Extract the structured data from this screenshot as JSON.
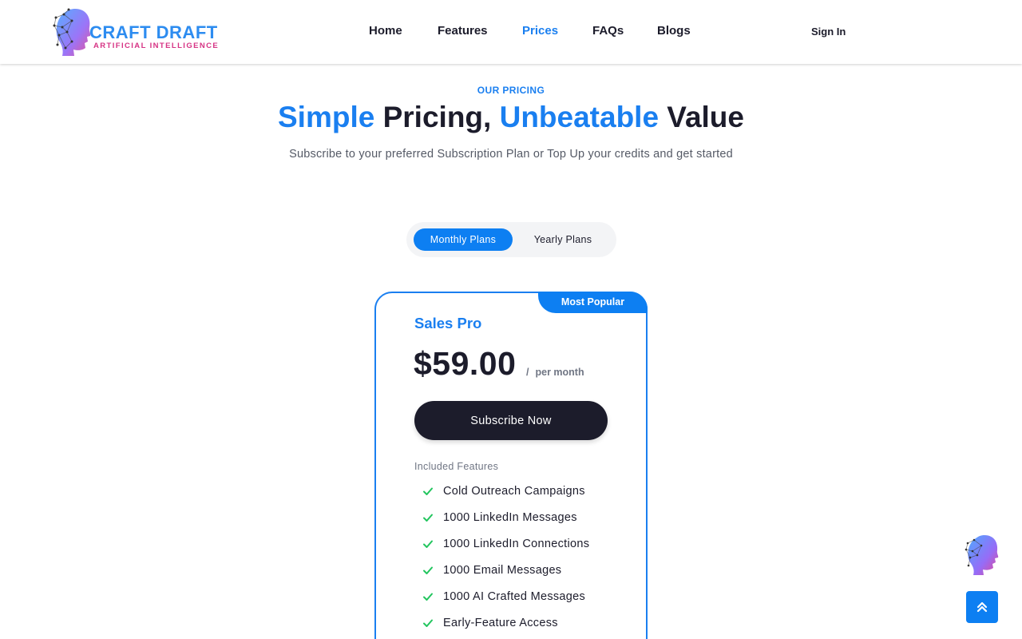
{
  "header": {
    "logo": {
      "title": "CRAFT DRAFT",
      "subtitle": "ARTIFICIAL INTELLIGENCE"
    },
    "nav": [
      {
        "label": "Home",
        "active": false
      },
      {
        "label": "Features",
        "active": false
      },
      {
        "label": "Prices",
        "active": true
      },
      {
        "label": "FAQs",
        "active": false
      },
      {
        "label": "Blogs",
        "active": false
      }
    ],
    "sign_in": "Sign In"
  },
  "hero": {
    "eyebrow": "OUR PRICING",
    "headline": {
      "part1": "Simple",
      "part2": " Pricing, ",
      "part3": "Unbeatable",
      "part4": " Value"
    },
    "subtitle": "Subscribe to your preferred Subscription Plan or Top Up your credits and get started"
  },
  "billing_toggle": {
    "options": [
      "Monthly Plans",
      "Yearly Plans"
    ],
    "selected": "Monthly Plans"
  },
  "plan": {
    "badge": "Most Popular",
    "name": "Sales Pro",
    "price": "$59.00",
    "separator": "/",
    "period": "per month",
    "cta": "Subscribe Now",
    "features_heading": "Included Features",
    "features": [
      "Cold Outreach Campaigns",
      "1000 LinkedIn Messages",
      "1000 LinkedIn Connections",
      "1000 Email Messages",
      "1000 AI Crafted Messages",
      "Early-Feature Access"
    ]
  },
  "colors": {
    "accent": "#1a7ff0",
    "dark": "#1c1c2b",
    "check": "#22c55e",
    "logo_magenta": "#d63384"
  },
  "icons": {
    "chat_bot": "ai-head-icon",
    "scroll_top": "chevrons-up-icon",
    "feature_check": "check-icon"
  }
}
